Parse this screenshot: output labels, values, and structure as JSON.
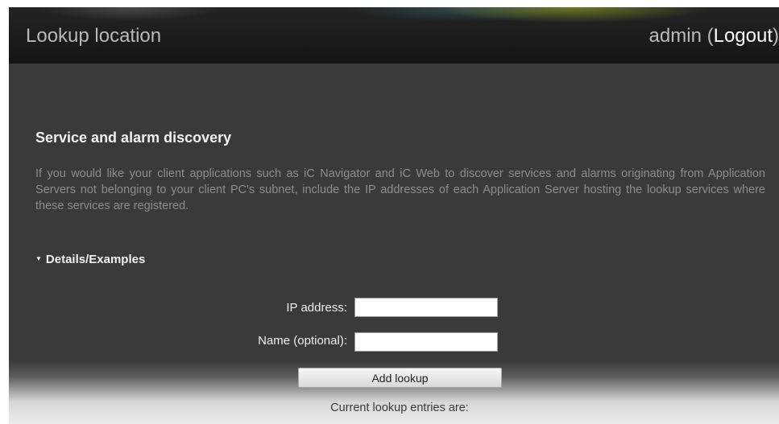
{
  "header": {
    "title": "Lookup location",
    "user": "admin",
    "logout_open": " (",
    "logout_label": "Logout",
    "logout_close": ")"
  },
  "section": {
    "title": "Service and alarm discovery",
    "description": "If you would like your client applications such as iC Navigator and iC Web to discover services and alarms originating from Application Servers not belonging to your client PC's subnet, include the IP addresses of each Application Server hosting the lookup services where these services are registered."
  },
  "details": {
    "toggle_icon": "triangle-down-icon",
    "label": "Details/Examples"
  },
  "form": {
    "ip_label": "IP address:",
    "ip_value": "",
    "name_label": "Name (optional):",
    "name_value": "",
    "add_button": "Add lookup"
  },
  "entries": {
    "label": "Current lookup entries are:"
  },
  "colors": {
    "background": "#3a3a3a",
    "header": "#1b1b1b",
    "text_heading": "#f0f0f0",
    "text_body": "#8d8d8d"
  }
}
